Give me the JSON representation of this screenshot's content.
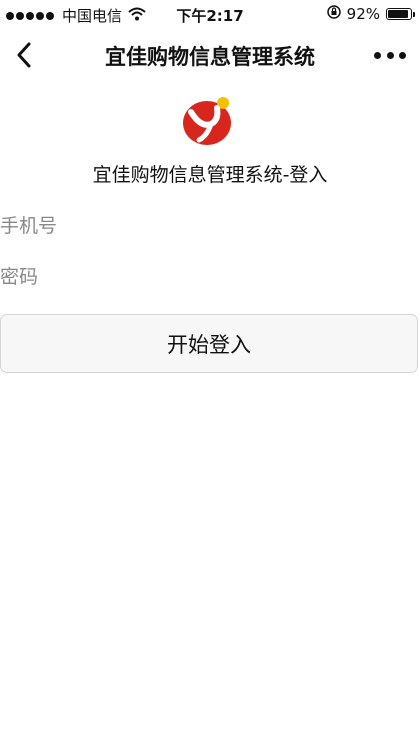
{
  "status_bar": {
    "carrier": "中国电信",
    "time": "下午2:17",
    "battery": "92%",
    "battery_level": 0.92,
    "signal_icon": "signal-dots-icon",
    "wifi_icon": "wifi-icon",
    "lock_icon": "rotation-lock-icon"
  },
  "nav": {
    "title": "宜佳购物信息管理系统",
    "back_icon": "chevron-left-icon",
    "more_icon": "more-dots-icon"
  },
  "logo": {
    "icon": "brand-logo",
    "primary_color": "#d7261e",
    "accent_color": "#f2c100"
  },
  "login": {
    "title": "宜佳购物信息管理系统-登入",
    "phone_placeholder": "手机号",
    "phone_value": "",
    "password_placeholder": "密码",
    "password_value": "",
    "submit_label": "开始登入"
  }
}
